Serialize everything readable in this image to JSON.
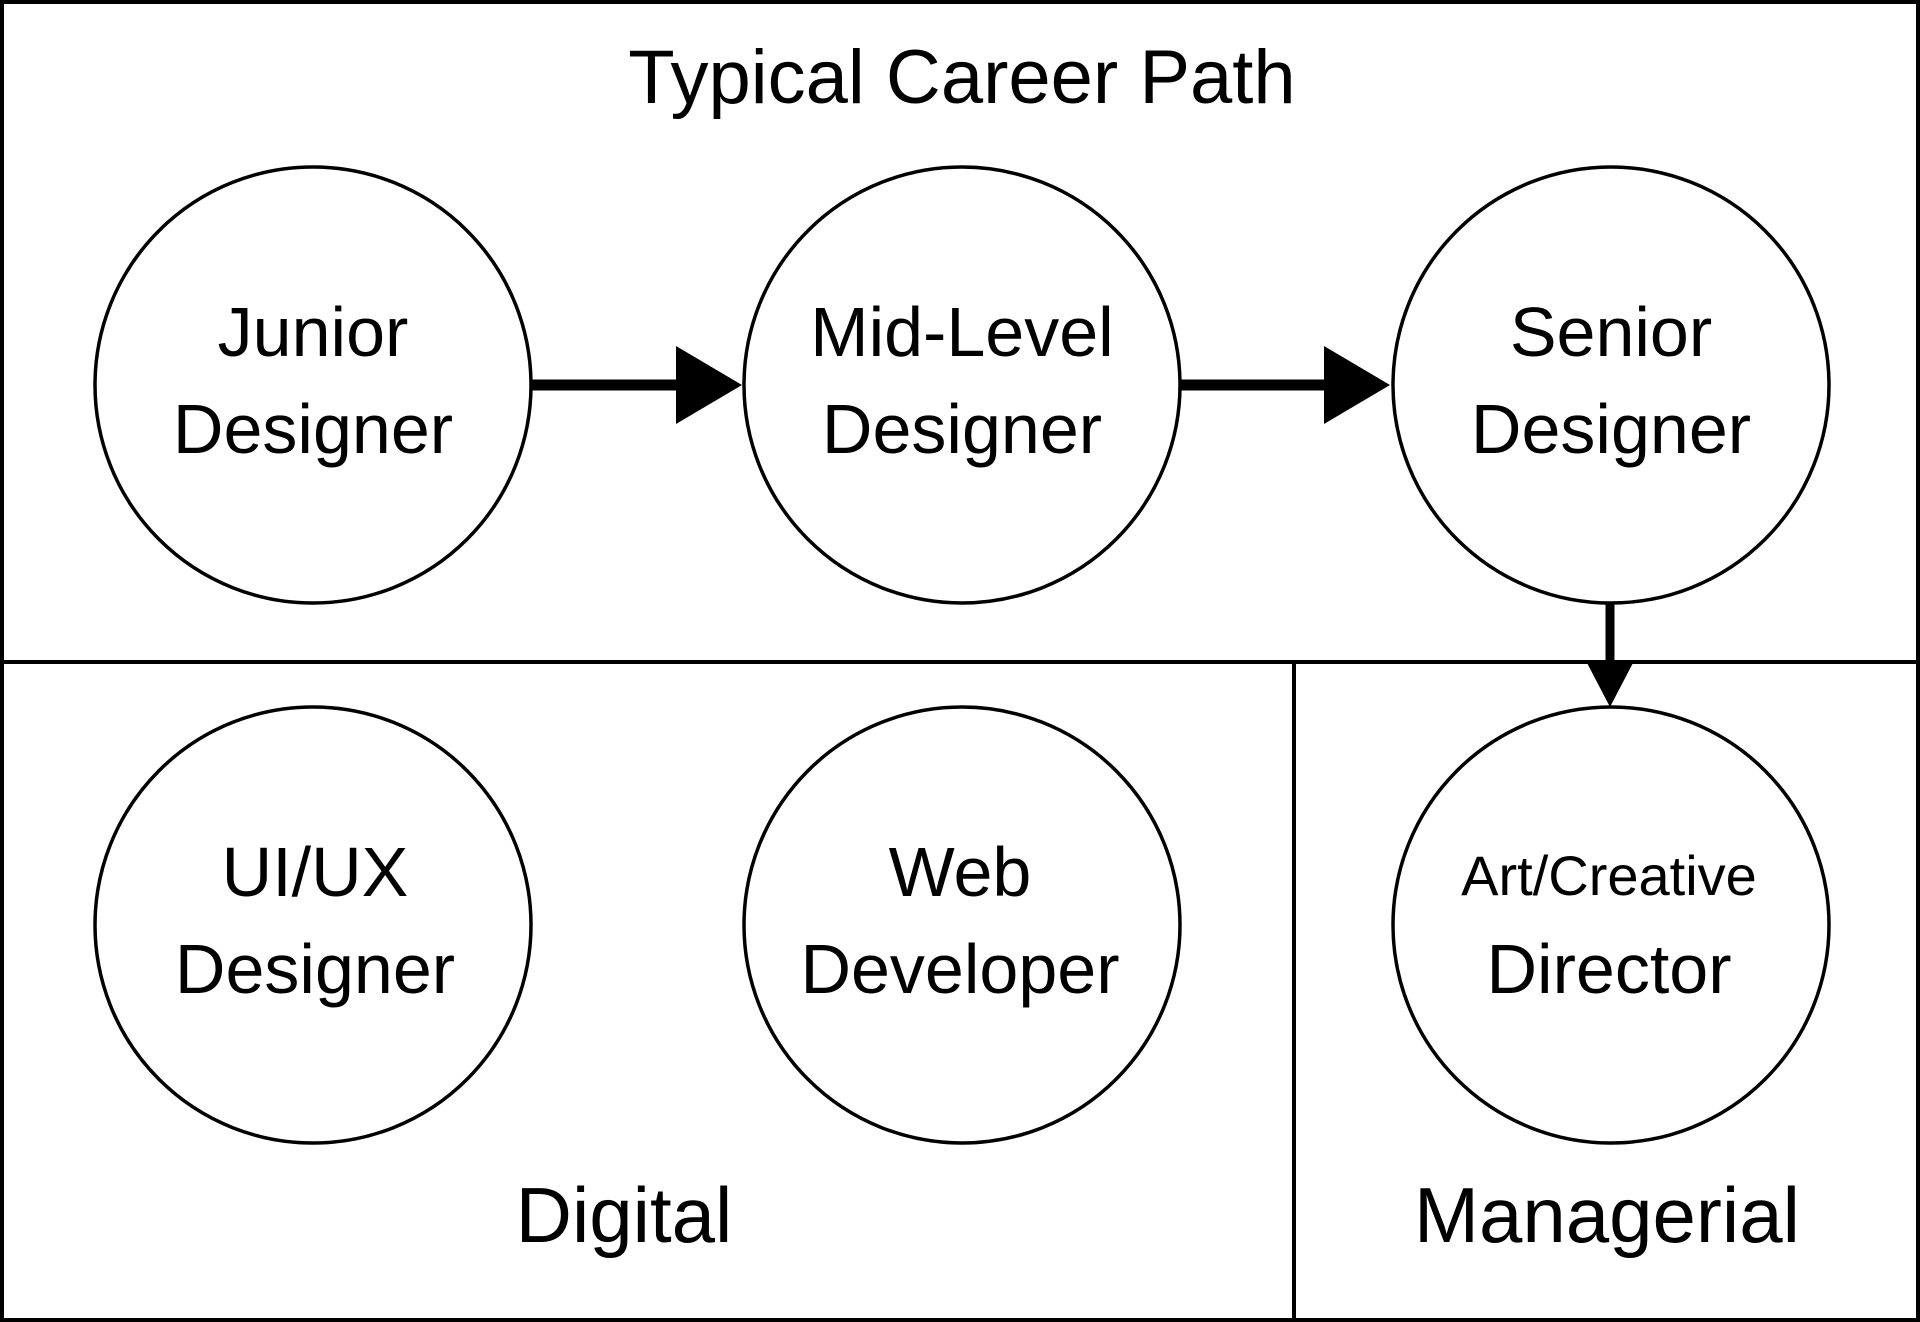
{
  "title": "Typical Career Path",
  "colors": {
    "stroke": "#000000",
    "background": "#ffffff",
    "text": "#000000"
  },
  "sections": {
    "digital": "Digital",
    "managerial": "Managerial"
  },
  "nodes": {
    "junior": {
      "line1": "Junior",
      "line2": "Designer"
    },
    "mid": {
      "line1": "Mid-Level",
      "line2": "Designer"
    },
    "senior": {
      "line1": "Senior",
      "line2": "Designer"
    },
    "uiux": {
      "line1": "UI/UX",
      "line2": "Designer"
    },
    "web": {
      "line1": "Web",
      "line2": "Developer"
    },
    "director": {
      "line1": "Art/Creative",
      "line2": "Director"
    }
  },
  "edges": [
    {
      "from": "Junior Designer",
      "to": "Mid-Level Designer"
    },
    {
      "from": "Mid-Level Designer",
      "to": "Senior Designer"
    },
    {
      "from": "Senior Designer",
      "to": "Art/Creative Director"
    }
  ]
}
